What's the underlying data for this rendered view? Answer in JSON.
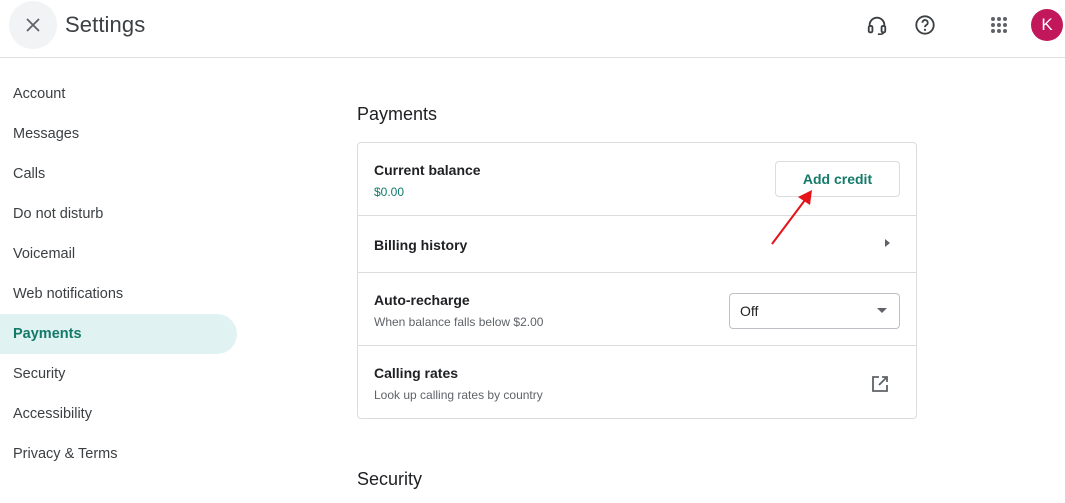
{
  "colors": {
    "accent": "#137a6a",
    "active_bg": "#e0f2f1",
    "avatar_bg": "#c2185b",
    "annotation_red": "#e5141b"
  },
  "header": {
    "title": "Settings",
    "avatar_letter": "K",
    "icons": [
      "close-icon",
      "headset-icon",
      "help-icon",
      "apps-grid-icon"
    ]
  },
  "sidebar": {
    "items": [
      {
        "label": "Account"
      },
      {
        "label": "Messages"
      },
      {
        "label": "Calls"
      },
      {
        "label": "Do not disturb"
      },
      {
        "label": "Voicemail"
      },
      {
        "label": "Web notifications"
      },
      {
        "label": "Payments",
        "active": true
      },
      {
        "label": "Security"
      },
      {
        "label": "Accessibility"
      },
      {
        "label": "Privacy & Terms"
      }
    ]
  },
  "payments": {
    "title": "Payments",
    "balance": {
      "label": "Current balance",
      "value": "$0.00",
      "button_label": "Add credit"
    },
    "billing_history": {
      "label": "Billing history"
    },
    "auto_recharge": {
      "label": "Auto-recharge",
      "sub": "When balance falls below $2.00",
      "selected": "Off"
    },
    "calling_rates": {
      "label": "Calling rates",
      "sub": "Look up calling rates by country"
    }
  },
  "security": {
    "title": "Security"
  }
}
